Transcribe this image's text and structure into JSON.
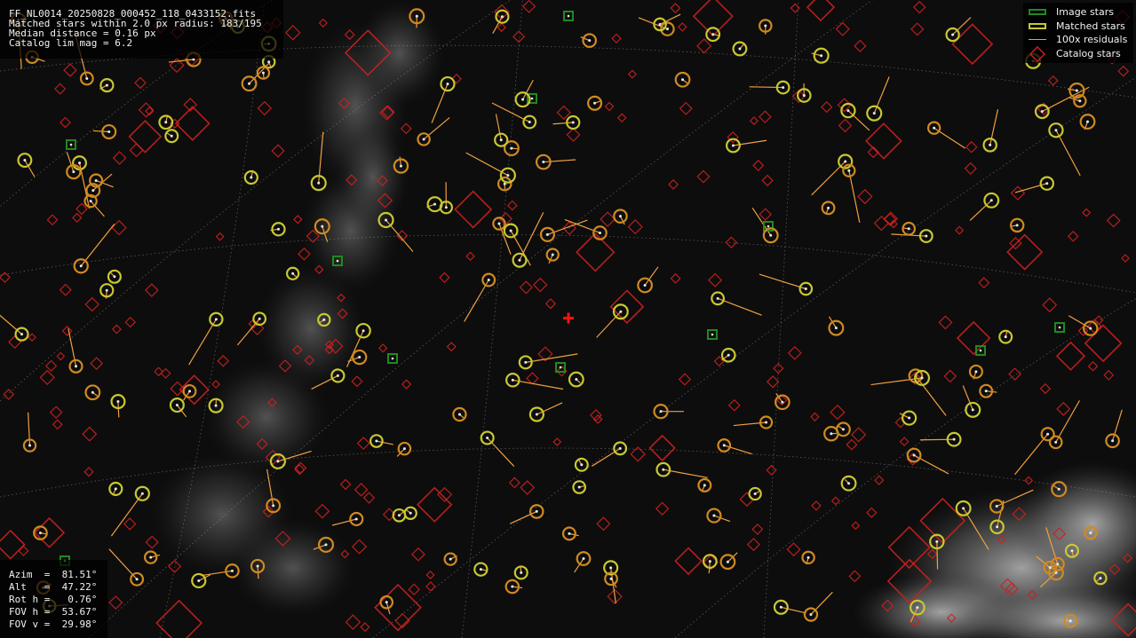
{
  "info_panel": {
    "filename": "FF_NL0014_20250828_000452_118_0433152.fits",
    "matched_text": "Matched stars within 2.0 px radius: 183/195",
    "median_text": "Median distance = 0.16 px",
    "limmag_text": "Catalog lim mag = 6.2"
  },
  "legend": {
    "image_stars": "Image stars",
    "matched_stars": "Matched stars",
    "residuals": "100x residuals",
    "catalog_stars": "Catalog stars"
  },
  "pointing": {
    "azim": "Azim  =  81.51°",
    "alt": "Alt   =  47.22°",
    "rot": "Rot h =   0.76°",
    "fovh": "FOV h =  53.67°",
    "fovv": "FOV v =  29.98°"
  },
  "colors": {
    "background": "#0b0b0b",
    "image_star": "#1f8a1f",
    "matched_star": "#c8c832",
    "residual": "#f0a040",
    "catalog_star": "#cc2020",
    "center_marker": "#ff1010",
    "grid": "#9a9a9a"
  },
  "icons": {
    "center_marker": "red-cross-icon"
  }
}
